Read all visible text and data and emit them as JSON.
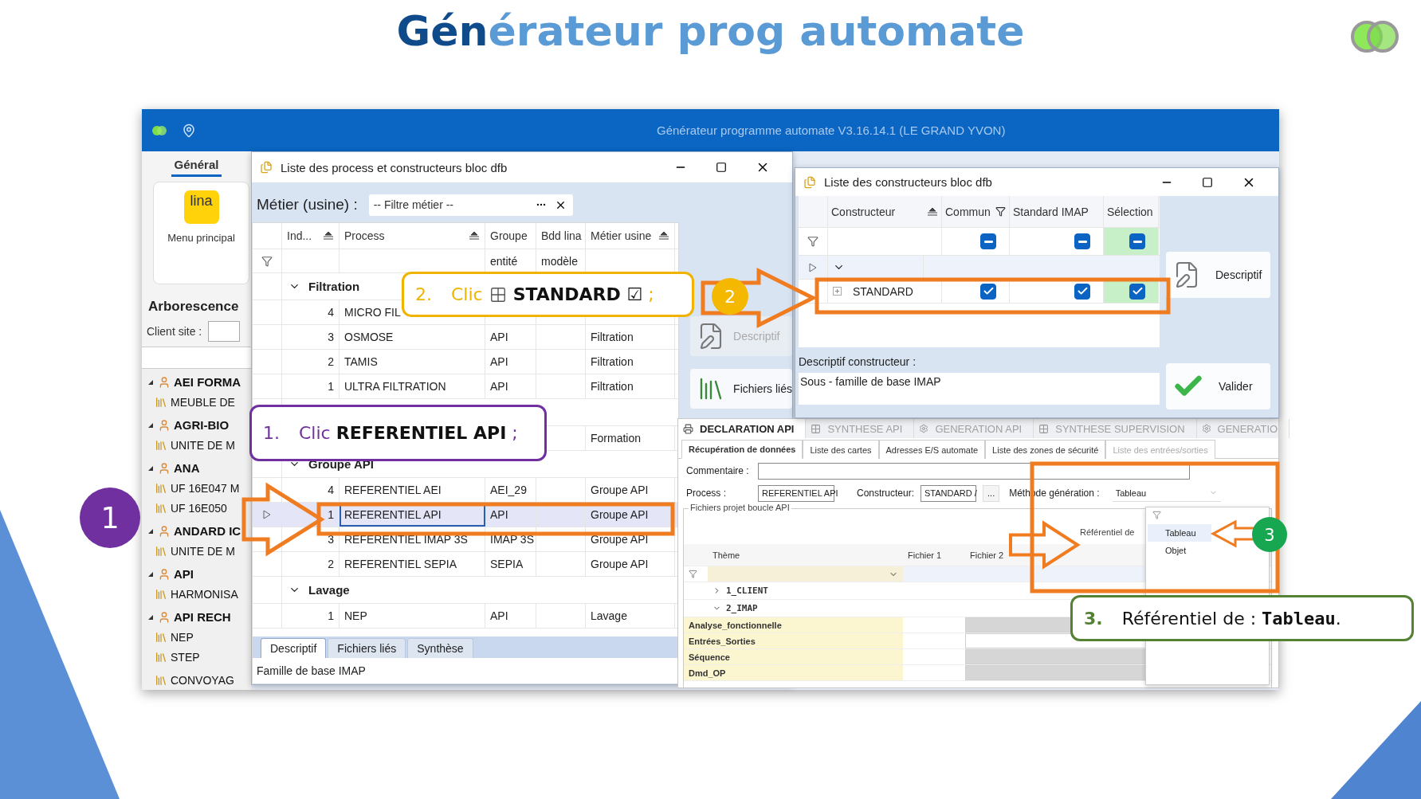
{
  "slide": {
    "title_dark": "Gén",
    "title_light": "érateur prog automate"
  },
  "app": {
    "title": "Générateur programme automate  V3.16.14.1  (LE GRAND YVON)"
  },
  "sidebar": {
    "tab": {
      "label": "Général",
      "selected": true
    },
    "menu": {
      "logo": "lina",
      "label": "Menu principal"
    },
    "section": "Arborescence",
    "client_label": "Client site :",
    "tree": [
      {
        "label": "AEI FORMA",
        "expanded": true,
        "children": [
          {
            "label": "MEUBLE DE"
          }
        ]
      },
      {
        "label": "AGRI-BIO",
        "expanded": true,
        "children": [
          {
            "label": "UNITE DE M"
          }
        ]
      },
      {
        "label": "ANA",
        "expanded": true,
        "children": [
          {
            "label": "UF 16E047 M"
          },
          {
            "label": "UF 16E050"
          }
        ]
      },
      {
        "label": "ANDARD IC",
        "expanded": true,
        "children": [
          {
            "label": "UNITE DE M"
          }
        ]
      },
      {
        "label": "API",
        "expanded": true,
        "children": [
          {
            "label": "HARMONISA"
          }
        ]
      },
      {
        "label": "API RECH",
        "expanded": true,
        "children": [
          {
            "label": "NEP"
          },
          {
            "label": "STEP"
          },
          {
            "label": "CONVOYAG"
          }
        ]
      }
    ]
  },
  "process_window": {
    "title": "Liste des process et constructeurs bloc dfb",
    "filter_label": "Métier (usine) :",
    "filter_placeholder": "-- Filtre métier --",
    "columns": [
      {
        "label": "Ind...",
        "sorted": true
      },
      {
        "label": "Process",
        "sorted": true
      },
      {
        "label": "Groupe",
        "sub": "entité"
      },
      {
        "label": "Bdd lina",
        "sub": "modèle"
      },
      {
        "label": "Métier usine",
        "sorted": true
      }
    ],
    "groups": [
      {
        "name": "Filtration",
        "expanded": true,
        "rows": [
          {
            "index": "4",
            "process": "MICRO FIL",
            "selected": false
          },
          {
            "index": "3",
            "process": "OSMOSE",
            "group": "API",
            "metier": "Filtration",
            "selected": false
          },
          {
            "index": "2",
            "process": "TAMIS",
            "group": "API",
            "metier": "Filtration",
            "selected": false
          },
          {
            "index": "1",
            "process": "ULTRA FILTRATION",
            "group": "API",
            "metier": "Filtration",
            "selected": false
          }
        ]
      },
      {
        "rows": [
          {
            "metier": "Formation",
            "selected": false
          }
        ]
      },
      {
        "name": "Groupe API",
        "expanded": true,
        "rows": [
          {
            "index": "4",
            "process": "REFERENTIEL AEI",
            "group": "AEI_29",
            "metier": "Groupe API",
            "selected": false
          },
          {
            "index": "1",
            "process": "REFERENTIEL API",
            "group": "API",
            "metier": "Groupe API",
            "selected": true
          },
          {
            "index": "3",
            "process": "REFERENTIEL IMAP 3S",
            "group": "IMAP 3S",
            "metier": "Groupe API",
            "selected": false
          },
          {
            "index": "2",
            "process": "REFERENTIEL SEPIA",
            "group": "SEPIA",
            "metier": "Groupe API",
            "selected": false
          }
        ]
      },
      {
        "name": "Lavage",
        "expanded": true,
        "rows": [
          {
            "index": "1",
            "process": "NEP",
            "group": "API",
            "metier": "Lavage",
            "selected": false
          }
        ]
      }
    ],
    "tabs": [
      {
        "label": "Descriptif",
        "selected": true
      },
      {
        "label": "Fichiers liés",
        "selected": false
      },
      {
        "label": "Synthèse",
        "selected": false
      }
    ],
    "description": "Famille de base IMAP",
    "side_buttons": [
      {
        "label": "Descriptif",
        "kind": "edit",
        "disabled": true
      },
      {
        "label": "Fichiers liés",
        "kind": "books",
        "disabled": false
      }
    ]
  },
  "constructor_window": {
    "title": "Liste des constructeurs bloc dfb",
    "columns": [
      {
        "label": "Constructeur",
        "sorted": true
      },
      {
        "label": "Commun",
        "filtered": true
      },
      {
        "label": "Standard IMAP"
      },
      {
        "label": "Sélection"
      }
    ],
    "filter_checks": [
      {
        "mixed": true
      },
      {
        "mixed": true
      },
      {
        "mixed": true
      }
    ],
    "group_expanded": true,
    "rows": [
      {
        "name": "STANDARD",
        "expanded": false,
        "checks": [
          {
            "checked": true
          },
          {
            "checked": true
          },
          {
            "checked": true
          }
        ]
      }
    ],
    "description_label": "Descriptif constructeur :",
    "description": "Sous - famille de base IMAP",
    "buttons": [
      {
        "label": "Descriptif",
        "kind": "edit"
      },
      {
        "label": "Valider",
        "kind": "confirm"
      }
    ]
  },
  "declaration_panel": {
    "tabs": [
      {
        "label": "DECLARATION API",
        "kind": "declaration",
        "selected": true,
        "disabled": false
      },
      {
        "label": "SYNTHESE API",
        "kind": "synthesis",
        "selected": false,
        "disabled": true
      },
      {
        "label": "GENERATION API",
        "kind": "generation",
        "selected": false,
        "disabled": true
      },
      {
        "label": "SYNTHESE SUPERVISION",
        "kind": "synthesis",
        "selected": false,
        "disabled": true
      },
      {
        "label": "GENERATIO",
        "kind": "generation",
        "selected": false,
        "disabled": true
      }
    ],
    "subtabs": [
      {
        "label": "Récupération de données",
        "selected": true,
        "disabled": false
      },
      {
        "label": "Liste des cartes",
        "selected": false,
        "disabled": false
      },
      {
        "label": "Adresses E/S automate",
        "selected": false,
        "disabled": false
      },
      {
        "label": "Liste des zones de sécurité",
        "selected": false,
        "disabled": false
      },
      {
        "label": "Liste des entrées/sorties",
        "selected": false,
        "disabled": true
      }
    ],
    "comment_label": "Commentaire :",
    "process_label": "Process :",
    "process_value": "REFERENTIEL API",
    "constructor_label": "Constructeur:",
    "constructor_value": "STANDARD /",
    "browse": "...",
    "method_label": "Méthode génération :",
    "method_value": "Tableau",
    "method_options": [
      {
        "label": "Tableau",
        "selected": true
      },
      {
        "label": "Objet",
        "selected": false
      }
    ],
    "files_group": "Fichiers projet boucle API",
    "referential_label": "Référentiel de",
    "columns": [
      "Thème",
      "Fichier 1",
      "Fichier 2"
    ],
    "themes": [
      {
        "label": "1_CLIENT",
        "expanded": false
      },
      {
        "label": "2_IMAP",
        "expanded": true,
        "children": [
          {
            "label": "Analyse_fonctionnelle",
            "file_2_greyed": true
          },
          {
            "label": "Entrées_Sorties",
            "file_2_greyed": false
          },
          {
            "label": "Séquence",
            "file_2_greyed": true
          },
          {
            "label": "Dmd_OP",
            "file_2_greyed": true
          }
        ]
      }
    ]
  },
  "callouts": [
    {
      "number": "1.",
      "color": "#7030a0",
      "verb": "Clic",
      "icon": false,
      "target": "REFERENTIEL API",
      "target_mono": false,
      "end": ";"
    },
    {
      "number": "2.",
      "color": "#f0b400",
      "verb": "Clic",
      "icon": true,
      "target": "STANDARD ☑",
      "target_mono": false,
      "end": ";"
    },
    {
      "number": "3.",
      "color": "#548235",
      "verb": "Référentiel de :",
      "icon": false,
      "target": "Tableau",
      "target_mono": true,
      "end": "."
    }
  ],
  "markers": [
    {
      "label": "1",
      "color": "#7030a0"
    },
    {
      "label": "2",
      "color": "#f5b800"
    },
    {
      "label": "3",
      "color": "#17a751"
    }
  ]
}
